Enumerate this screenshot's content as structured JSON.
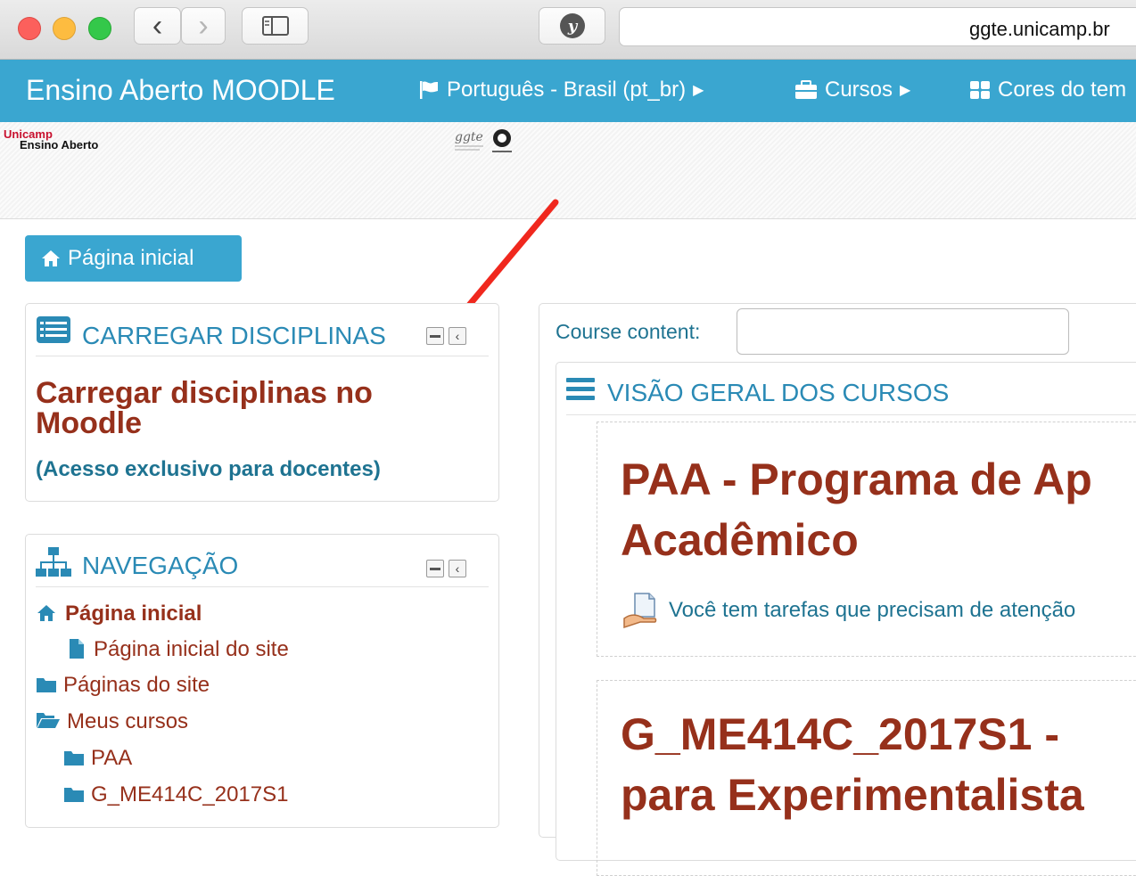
{
  "browser": {
    "url": "ggte.unicamp.br",
    "back_label": "‹",
    "forward_label": "›"
  },
  "topnav": {
    "brand": "Ensino Aberto MOODLE",
    "language": "Português - Brasil (pt_br)",
    "courses": "Cursos",
    "theme_colors": "Cores do tem"
  },
  "header": {
    "logo_line1": "Unicamp",
    "logo_line2": "Ensino Aberto"
  },
  "home_button": "Página inicial",
  "upload_block": {
    "title": "CARREGAR DISCIPLINAS",
    "heading_line1": "Carregar disciplinas no",
    "heading_line2": "Moodle",
    "subtitle": "(Acesso exclusivo para docentes)"
  },
  "nav_block": {
    "title": "NAVEGAÇÃO",
    "items": [
      {
        "label": "Página inicial"
      },
      {
        "label": "Página inicial do site"
      },
      {
        "label": "Páginas do site"
      },
      {
        "label": "Meus cursos"
      },
      {
        "label": "PAA"
      },
      {
        "label": "G_ME414C_2017S1"
      }
    ]
  },
  "main": {
    "search_label": "Course content:",
    "search_value": "",
    "overview_title": "VISÃO GERAL DOS CURSOS",
    "courses": [
      {
        "title_line1": "PAA - Programa de Ap",
        "title_line2": "Acadêmico",
        "notice": "Você tem tarefas que precisam de atenção"
      },
      {
        "title_line1": "G_ME414C_2017S1 -",
        "title_line2": "para Experimentalista"
      }
    ]
  },
  "colors": {
    "accent": "#3aa6d0",
    "title_red": "#96301b",
    "link_blue": "#2a8ab5",
    "arrow": "#f0281e"
  }
}
